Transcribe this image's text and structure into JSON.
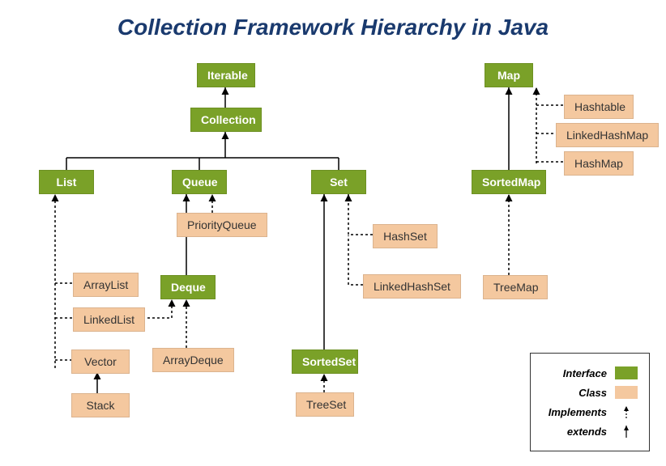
{
  "title": "Collection Framework Hierarchy in Java",
  "nodes": {
    "iterable": "Iterable",
    "collection": "Collection",
    "list": "List",
    "queue": "Queue",
    "set": "Set",
    "deque": "Deque",
    "sortedset": "SortedSet",
    "map": "Map",
    "sortedmap": "SortedMap",
    "arraylist": "ArrayList",
    "linkedlist": "LinkedList",
    "vector": "Vector",
    "stack": "Stack",
    "priorityqueue": "PriorityQueue",
    "arraydeque": "ArrayDeque",
    "hashset": "HashSet",
    "linkedhashset": "LinkedHashSet",
    "treeset": "TreeSet",
    "hashtable": "Hashtable",
    "linkedhashmap": "LinkedHashMap",
    "hashmap": "HashMap",
    "treemap": "TreeMap"
  },
  "legend": {
    "interface": "Interface",
    "class": "Class",
    "implements": "Implements",
    "extends": "extends"
  }
}
